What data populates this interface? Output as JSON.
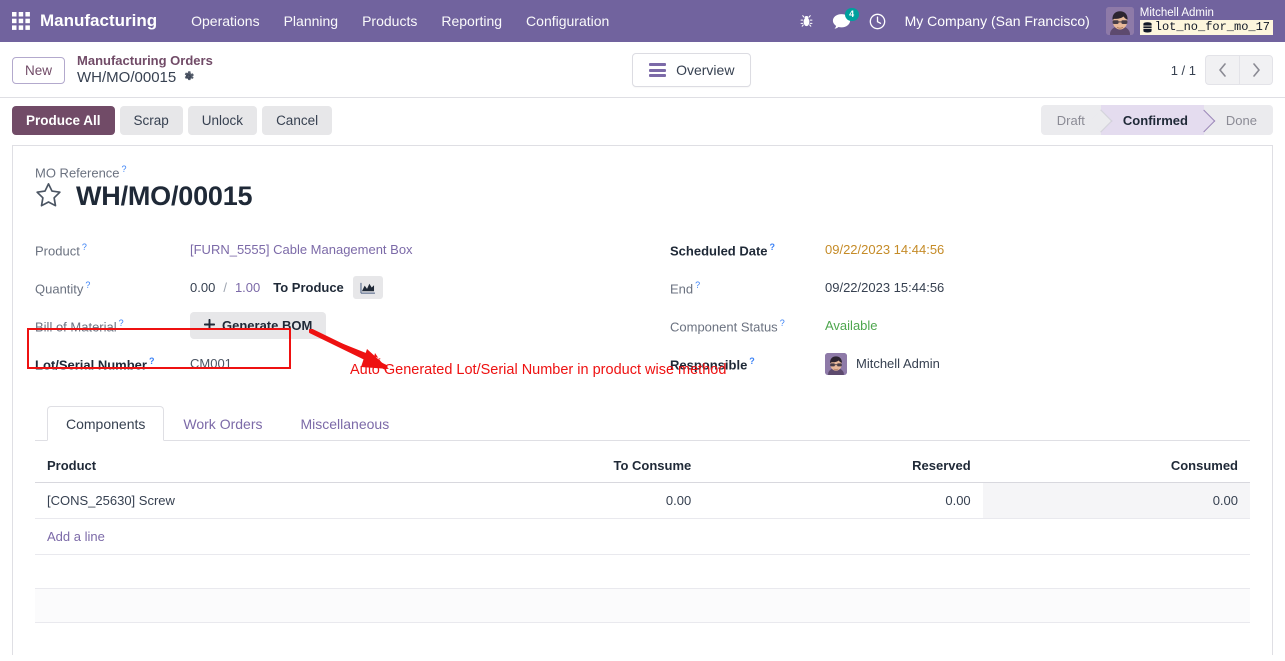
{
  "navbar": {
    "apps_icon": "apps-grid-icon",
    "brand": "Manufacturing",
    "menu": [
      {
        "label": "Operations"
      },
      {
        "label": "Planning"
      },
      {
        "label": "Products"
      },
      {
        "label": "Reporting"
      },
      {
        "label": "Configuration"
      }
    ],
    "debug_icon": "bug-icon",
    "messages_icon": "chat-bubble-icon",
    "messages_count": "4",
    "activities_icon": "clock-icon",
    "company": "My Company (San Francisco)",
    "user_name": "Mitchell Admin",
    "database_icon": "database-icon",
    "database": "lot_no_for_mo_17",
    "brand_color": "#71639e",
    "badge_color": "#00a09d"
  },
  "control_panel": {
    "new_label": "New",
    "breadcrumb_parent": "Manufacturing Orders",
    "breadcrumb_current": "WH/MO/00015",
    "gear_icon": "gear-icon",
    "overview_label": "Overview",
    "overview_icon": "bars-icon",
    "pager_value": "1 / 1",
    "pager_prev_icon": "chevron-left-icon",
    "pager_next_icon": "chevron-right-icon"
  },
  "action_bar": {
    "buttons": [
      {
        "label": "Produce All",
        "style": "primary"
      },
      {
        "label": "Scrap",
        "style": "secondary"
      },
      {
        "label": "Unlock",
        "style": "secondary"
      },
      {
        "label": "Cancel",
        "style": "secondary"
      }
    ],
    "statuses": [
      {
        "label": "Draft",
        "active": false
      },
      {
        "label": "Confirmed",
        "active": true
      },
      {
        "label": "Done",
        "active": false
      }
    ],
    "primary_color": "#714b67",
    "active_status_color": "#e4dcef"
  },
  "form": {
    "mo_reference_label": "MO Reference",
    "star_icon": "star-icon",
    "title": "WH/MO/00015",
    "left_fields": {
      "product_label": "Product",
      "product_value": "[FURN_5555] Cable Management Box",
      "quantity_label": "Quantity",
      "quantity_done": "0.00",
      "quantity_sep": "/",
      "quantity_target": "1.00",
      "to_produce_label": "To Produce",
      "forecast_icon": "area-chart-icon",
      "bom_label": "Bill of Material",
      "generate_bom_label": "Generate BOM",
      "generate_bom_icon": "plus-icon",
      "lot_label": "Lot/Serial Number",
      "lot_value": "CM001"
    },
    "right_fields": {
      "scheduled_date_label": "Scheduled Date",
      "scheduled_date_value": "09/22/2023 14:44:56",
      "end_label": "End",
      "end_value": "09/22/2023 15:44:56",
      "component_status_label": "Component Status",
      "component_status_value": "Available",
      "responsible_label": "Responsible",
      "responsible_value": "Mitchell Admin",
      "responsible_avatar": "avatar-icon"
    },
    "annotation": {
      "caption": "Auto Generated Lot/Serial Number in product wise method",
      "color": "#ee1111",
      "highlight_target": "Lot/Serial Number",
      "arrow_icon": "arrow-down-right-icon"
    }
  },
  "notebook": {
    "tabs": [
      {
        "label": "Components",
        "active": true
      },
      {
        "label": "Work Orders",
        "active": false
      },
      {
        "label": "Miscellaneous",
        "active": false
      }
    ],
    "table": {
      "columns": [
        "Product",
        "To Consume",
        "Reserved",
        "Consumed"
      ],
      "rows": [
        {
          "product": "[CONS_25630] Screw",
          "to_consume": "0.00",
          "reserved": "0.00",
          "consumed": "0.00"
        }
      ],
      "add_line_label": "Add a line"
    }
  }
}
